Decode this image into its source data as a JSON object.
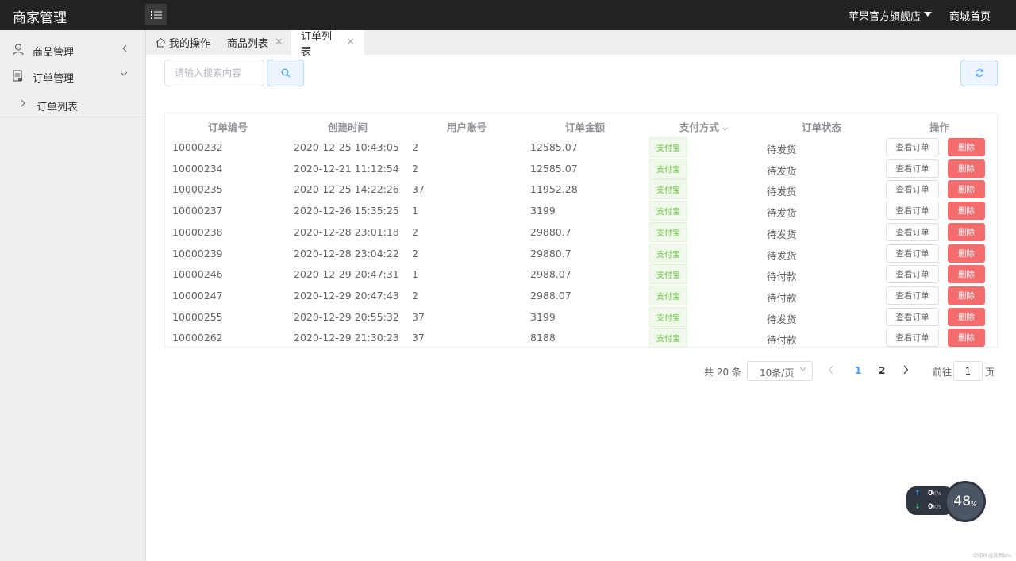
{
  "header": {
    "brand": "商家管理",
    "store_name": "苹果官方旗舰店",
    "home_link": "商城首页"
  },
  "sidebar": {
    "items": [
      {
        "label": "商品管理",
        "icon": "user-icon"
      },
      {
        "label": "订单管理",
        "icon": "order-icon"
      }
    ],
    "sub_item": "订单列表"
  },
  "tabs": [
    {
      "label": "我的操作"
    },
    {
      "label": "商品列表"
    },
    {
      "label": "订单列表"
    }
  ],
  "search": {
    "placeholder": "请输入搜索内容"
  },
  "table": {
    "columns": [
      "订单编号",
      "创建时间",
      "用户账号",
      "订单金额",
      "支付方式",
      "订单状态",
      "操作"
    ],
    "rows": [
      {
        "id": "10000232",
        "time": "2020-12-25 10:43:05",
        "user": "2",
        "amount": "12585.07",
        "pay": "支付宝",
        "status": "待发货",
        "view": "查看订单",
        "del": "删除"
      },
      {
        "id": "10000234",
        "time": "2020-12-21 11:12:54",
        "user": "2",
        "amount": "12585.07",
        "pay": "支付宝",
        "status": "待发货",
        "view": "查看订单",
        "del": "删除"
      },
      {
        "id": "10000235",
        "time": "2020-12-25 14:22:26",
        "user": "37",
        "amount": "11952.28",
        "pay": "支付宝",
        "status": "待发货",
        "view": "查看订单",
        "del": "删除"
      },
      {
        "id": "10000237",
        "time": "2020-12-26 15:35:25",
        "user": "1",
        "amount": "3199",
        "pay": "支付宝",
        "status": "待发货",
        "view": "查看订单",
        "del": "删除"
      },
      {
        "id": "10000238",
        "time": "2020-12-28 23:01:18",
        "user": "2",
        "amount": "29880.7",
        "pay": "支付宝",
        "status": "待发货",
        "view": "查看订单",
        "del": "删除"
      },
      {
        "id": "10000239",
        "time": "2020-12-28 23:04:22",
        "user": "2",
        "amount": "29880.7",
        "pay": "支付宝",
        "status": "待发货",
        "view": "查看订单",
        "del": "删除"
      },
      {
        "id": "10000246",
        "time": "2020-12-29 20:47:31",
        "user": "1",
        "amount": "2988.07",
        "pay": "支付宝",
        "status": "待付款",
        "view": "查看订单",
        "del": "删除"
      },
      {
        "id": "10000247",
        "time": "2020-12-29 20:47:43",
        "user": "2",
        "amount": "2988.07",
        "pay": "支付宝",
        "status": "待付款",
        "view": "查看订单",
        "del": "删除"
      },
      {
        "id": "10000255",
        "time": "2020-12-29 20:55:32",
        "user": "37",
        "amount": "3199",
        "pay": "支付宝",
        "status": "待发货",
        "view": "查看订单",
        "del": "删除"
      },
      {
        "id": "10000262",
        "time": "2020-12-29 21:30:23",
        "user": "37",
        "amount": "8188",
        "pay": "支付宝",
        "status": "待付款",
        "view": "查看订单",
        "del": "删除"
      }
    ]
  },
  "pagination": {
    "total": "共 20 条",
    "page_size": "10条/页",
    "pages": [
      "1",
      "2"
    ],
    "goto_prefix": "前往",
    "goto_value": "1",
    "goto_suffix": "页"
  },
  "net_widget": {
    "up": "0",
    "down": "0",
    "unit": "K/s",
    "percent": "48",
    "percent_sign": "%"
  },
  "watermark": "CSDN @沈风bzu"
}
